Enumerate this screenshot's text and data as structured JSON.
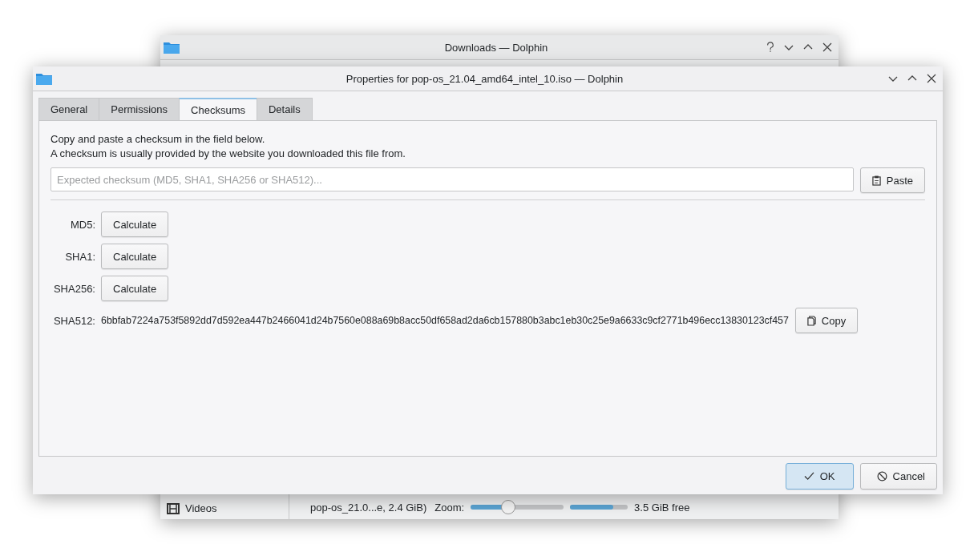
{
  "background_window": {
    "title": "Downloads — Dolphin",
    "places": [
      {
        "label": "Videos"
      }
    ],
    "status_text": "pop-os_21.0...e, 2.4 GiB)",
    "zoom_label": "Zoom:",
    "zoom": {
      "level": 0.4
    },
    "space": {
      "level": 0.75
    },
    "free_space": "3.5 GiB free"
  },
  "dialog": {
    "title": "Properties for pop-os_21.04_amd64_intel_10.iso — Dolphin",
    "tabs": [
      {
        "label": "General",
        "selected": false
      },
      {
        "label": "Permissions",
        "selected": false
      },
      {
        "label": "Checksums",
        "selected": true
      },
      {
        "label": "Details",
        "selected": false
      }
    ],
    "intro": [
      "Copy and paste a checksum in the field below.",
      "A checksum is usually provided by the website you downloaded this file from."
    ],
    "checksum_field": {
      "placeholder": "Expected checksum (MD5, SHA1, SHA256 or SHA512)..."
    },
    "paste_button": "Paste",
    "checksums": [
      {
        "label": "MD5:",
        "kind": "calculate",
        "button": "Calculate"
      },
      {
        "label": "SHA1:",
        "kind": "calculate",
        "button": "Calculate"
      },
      {
        "label": "SHA256:",
        "kind": "calculate",
        "button": "Calculate"
      },
      {
        "label": "SHA512:",
        "kind": "result",
        "value": "6bbfab7224a753f5892dd7d592ea447b2466041d24b7560e088a69b8acc50df658ad2da6cb157880b3abc1eb30c25e9a6633c9cf2771b496ecc13830123cf457",
        "button": "Copy"
      }
    ],
    "buttons": [
      {
        "label": "OK",
        "kind": "default"
      },
      {
        "label": "Cancel",
        "kind": "cancel"
      }
    ]
  }
}
